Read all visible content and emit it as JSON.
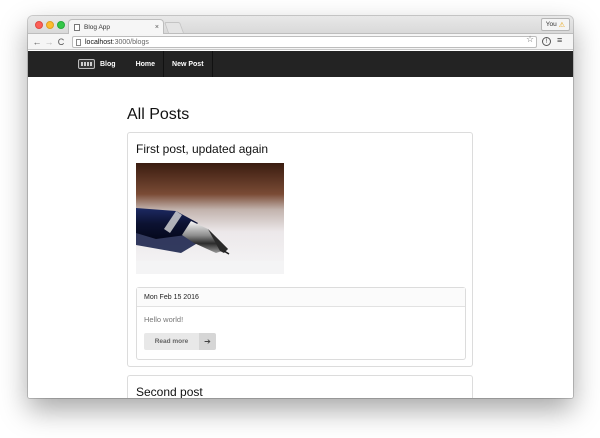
{
  "browser": {
    "tab_title": "Blog App",
    "tab_close": "×",
    "profile_label": "You",
    "url_host": "localhost",
    "url_path": ":3000/blogs",
    "back_glyph": "←",
    "forward_glyph": "→",
    "reload_glyph": "C",
    "star_glyph": "☆",
    "info_glyph": "!",
    "menu_glyph": "≡",
    "warn_glyph": "⚠"
  },
  "navbar": {
    "brand": "Blog",
    "links": [
      "Home",
      "New Post"
    ]
  },
  "page": {
    "heading": "All Posts"
  },
  "posts": [
    {
      "title": "First post, updated again",
      "date": "Mon Feb 15 2016",
      "body": "Hello world!",
      "read_more": "Read more",
      "arrow": "➔"
    },
    {
      "title": "Second post"
    }
  ],
  "colors": {
    "navbar_bg": "#232323",
    "accent_warn": "#e5a00d"
  }
}
